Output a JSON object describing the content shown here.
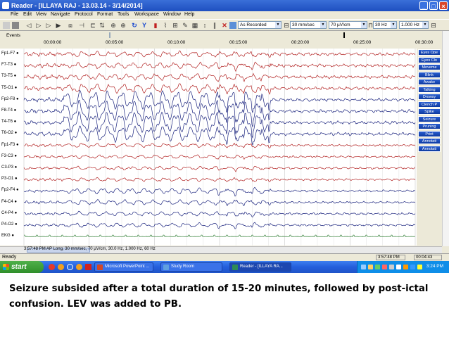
{
  "window": {
    "title": "Reader - [ILLAYA RAJ   - 13.03.14 - 3/14/2014]",
    "title_buttons": [
      "minimize-icon",
      "maximize-icon",
      "close-icon"
    ]
  },
  "menu": [
    "File",
    "Edit",
    "View",
    "Navigate",
    "Protocol",
    "Format",
    "Tools",
    "Workspace",
    "Window",
    "Help"
  ],
  "toolbar": {
    "icons": [
      "new-icon",
      "print-icon",
      "skip-back-icon",
      "back-icon",
      "play-icon",
      "forward-icon",
      "skip-forward-icon",
      "montage-icon",
      "filter-icon",
      "tool-icon",
      "zoom-icon",
      "undo-icon",
      "cursor-icon",
      "marker-icon",
      "notch-icon",
      "measure-icon",
      "grid-icon",
      "clear-icon",
      "calc-icon",
      "delete-icon"
    ],
    "montage": "As Recorded",
    "speed": "30 mm/sec",
    "sensitivity": "70 µV/cm",
    "hff": "30 Hz",
    "lff": "1.000 Hz"
  },
  "events_label": "Events",
  "ruler": [
    "00:00:00",
    "00:05:00",
    "00:10:00",
    "00:15:00",
    "00:20:00",
    "00:25:00",
    "00:30:00"
  ],
  "channels": [
    {
      "label": "Fp1-F7",
      "color": "#b22222",
      "amp": 4.5,
      "seizure": 0.8
    },
    {
      "label": "F7-T3",
      "color": "#b22222",
      "amp": 4.5,
      "seizure": 0.9
    },
    {
      "label": "T3-T5",
      "color": "#b22222",
      "amp": 4.5,
      "seizure": 1.0
    },
    {
      "label": "T5-O1",
      "color": "#b22222",
      "amp": 4.5,
      "seizure": 1.4
    },
    {
      "label": "Fp2-F8",
      "color": "#1a237e",
      "amp": 4.5,
      "seizure": 3.0
    },
    {
      "label": "F8-T4",
      "color": "#1a237e",
      "amp": 4.5,
      "seizure": 3.4
    },
    {
      "label": "T4-T6",
      "color": "#1a237e",
      "amp": 4.5,
      "seizure": 3.4
    },
    {
      "label": "T6-O2",
      "color": "#1a237e",
      "amp": 4.5,
      "seizure": 2.6
    },
    {
      "label": "Fp1-F3",
      "color": "#b22222",
      "amp": 3.0,
      "seizure": 1.0
    },
    {
      "label": "F3-C3",
      "color": "#b22222",
      "amp": 3.0,
      "seizure": 0.8
    },
    {
      "label": "C3-P3",
      "color": "#b22222",
      "amp": 3.0,
      "seizure": 0.8
    },
    {
      "label": "P3-O1",
      "color": "#b22222",
      "amp": 3.0,
      "seizure": 0.8
    },
    {
      "label": "Fp2-F4",
      "color": "#1a237e",
      "amp": 3.0,
      "seizure": 1.4
    },
    {
      "label": "F4-C4",
      "color": "#1a237e",
      "amp": 3.0,
      "seizure": 1.2
    },
    {
      "label": "C4-P4",
      "color": "#1a237e",
      "amp": 3.0,
      "seizure": 1.0
    },
    {
      "label": "P4-O2",
      "color": "#1a237e",
      "amp": 3.0,
      "seizure": 1.0
    },
    {
      "label": "EKG",
      "color": "#2e7d32",
      "amp": 1.5,
      "seizure": 0.0
    }
  ],
  "panel_buttons": [
    "Eyes Ope",
    "Eyes Clo",
    "Moveme",
    "Blink",
    "Awake",
    "Talking",
    "Drowsy",
    "Clench P",
    "Spike",
    "Seizure",
    "Pruning",
    "Print",
    "Annotati",
    "Annotati"
  ],
  "info_line": "3:57:48 PM AP Long, 30 mm/sec, 70 µV/cm, 30.0 Hz, 1.000 Hz, 60 Hz",
  "status": {
    "left": "Ready",
    "time": "3:57:48 PM",
    "duration": "00:04:43"
  },
  "taskbar": {
    "start": "start",
    "tasks": [
      {
        "label": "Microsoft PowerPoint ...",
        "color": "#d24726"
      },
      {
        "label": "Study Room",
        "color": "#5fa0e0"
      },
      {
        "label": "Reader - [ILLAYA RA...",
        "color": "#2e8b57"
      }
    ],
    "clock": "3:24 PM"
  },
  "caption": "Seizure subsided after a total duration of 15-20 minutes, followed by post-ictal confusion. LEV was added to PB."
}
